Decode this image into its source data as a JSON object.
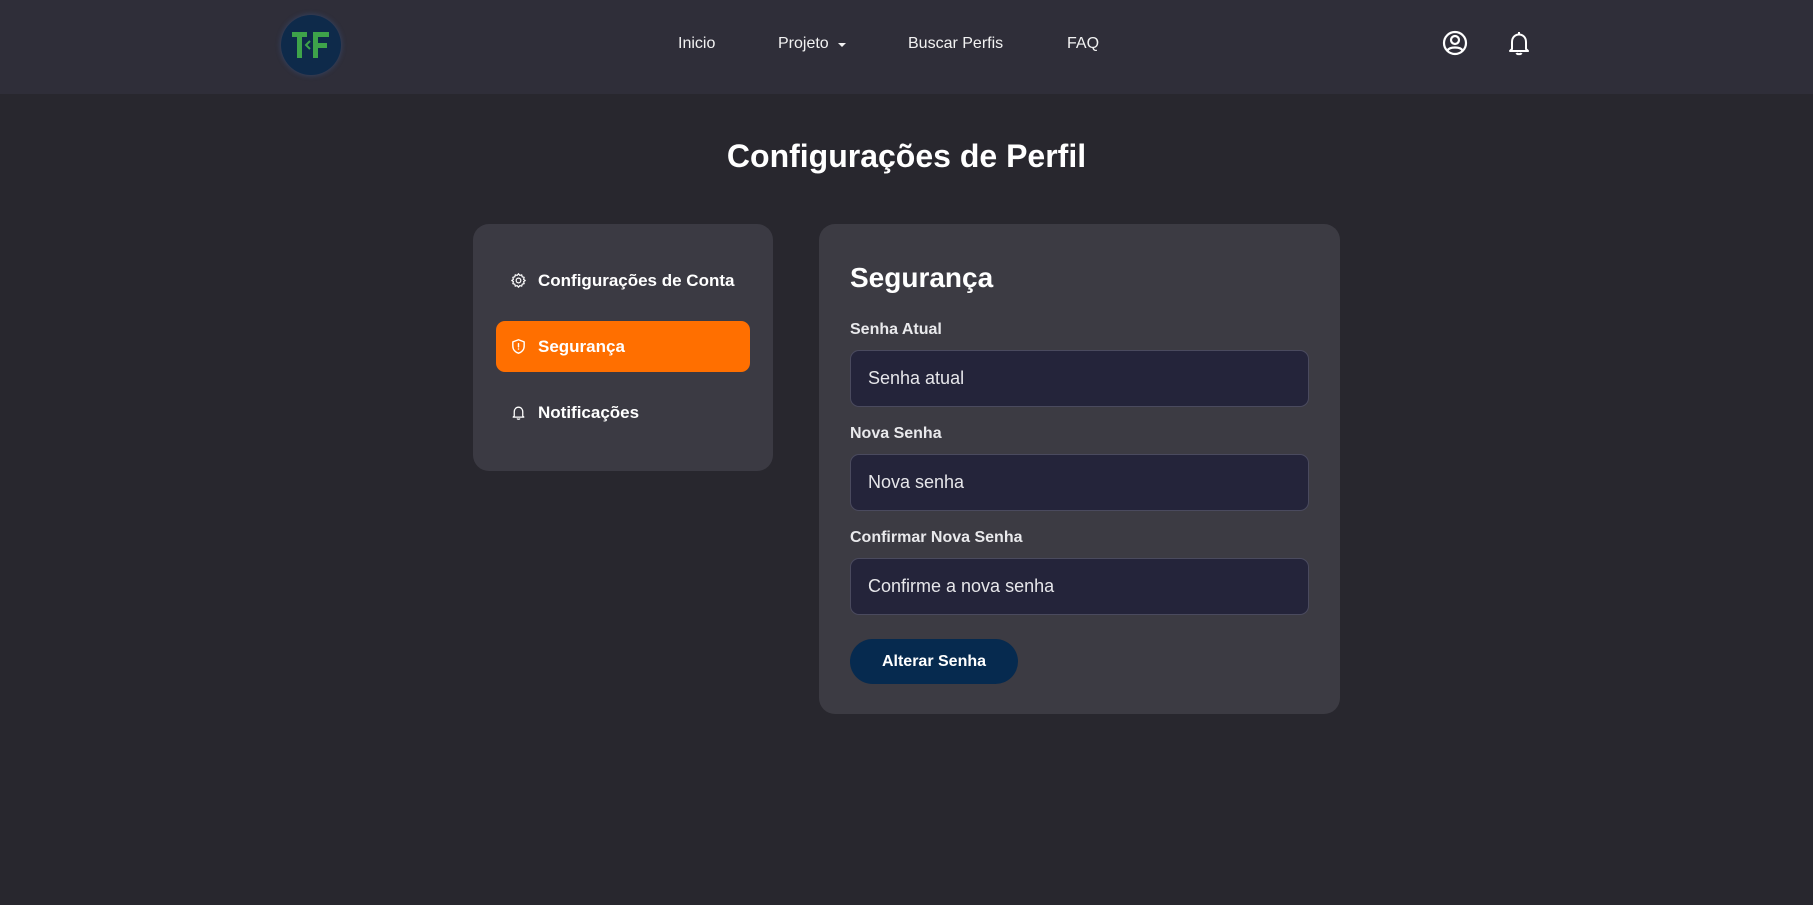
{
  "header": {
    "logo_text": "TF",
    "nav": [
      {
        "label": "Inicio"
      },
      {
        "label": "Projeto",
        "icon": "caret-down-icon"
      },
      {
        "label": "Buscar Perfis"
      },
      {
        "label": "FAQ"
      }
    ],
    "icons": [
      "user-circle-icon",
      "bell-icon"
    ]
  },
  "page": {
    "title": "Configurações de Perfil"
  },
  "sidebar": {
    "items": [
      {
        "label": "Configurações de Conta",
        "icon": "gear-icon",
        "active": false
      },
      {
        "label": "Segurança",
        "icon": "shield-icon",
        "active": true
      },
      {
        "label": "Notificações",
        "icon": "bell-icon",
        "active": false
      }
    ]
  },
  "security": {
    "title": "Segurança",
    "fields": [
      {
        "label": "Senha Atual",
        "placeholder": "Senha atual",
        "value": ""
      },
      {
        "label": "Nova Senha",
        "placeholder": "Nova senha",
        "value": ""
      },
      {
        "label": "Confirmar Nova Senha",
        "placeholder": "Confirme a nova senha",
        "value": ""
      }
    ],
    "submit_label": "Alterar Senha"
  },
  "colors": {
    "background": "#28272e",
    "header": "#2f2e39",
    "card": "#3c3b43",
    "accent": "#ff6f00",
    "input_bg": "#24243a",
    "button": "#062a4f",
    "logo_green": "#3ea34a"
  }
}
